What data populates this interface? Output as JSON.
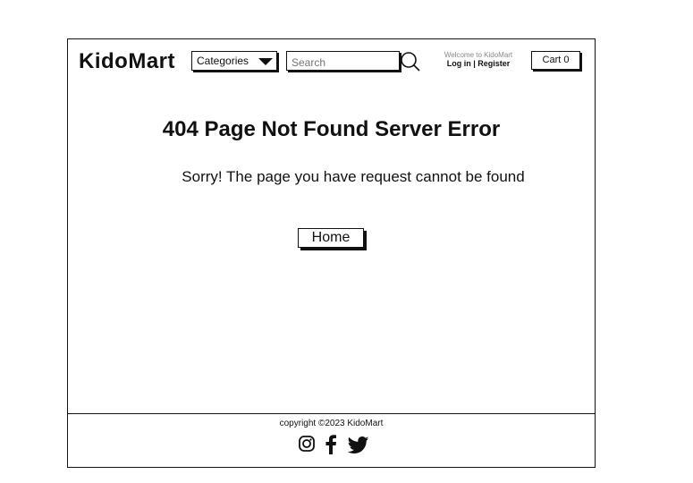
{
  "header": {
    "logo": "KidoMart",
    "categories_label": "Categories",
    "search_placeholder": "Search",
    "welcome_text": "Welcome to KidoMart",
    "login_register": "Log in | Register",
    "cart_label": "Cart 0"
  },
  "main": {
    "title": "404 Page Not Found Server Error",
    "message": "Sorry! The page you have request cannot be found",
    "home_button": "Home"
  },
  "footer": {
    "copyright": "copyright ©2023 KidoMart",
    "social_icons": [
      "instagram-icon",
      "facebook-icon",
      "twitter-icon"
    ]
  }
}
